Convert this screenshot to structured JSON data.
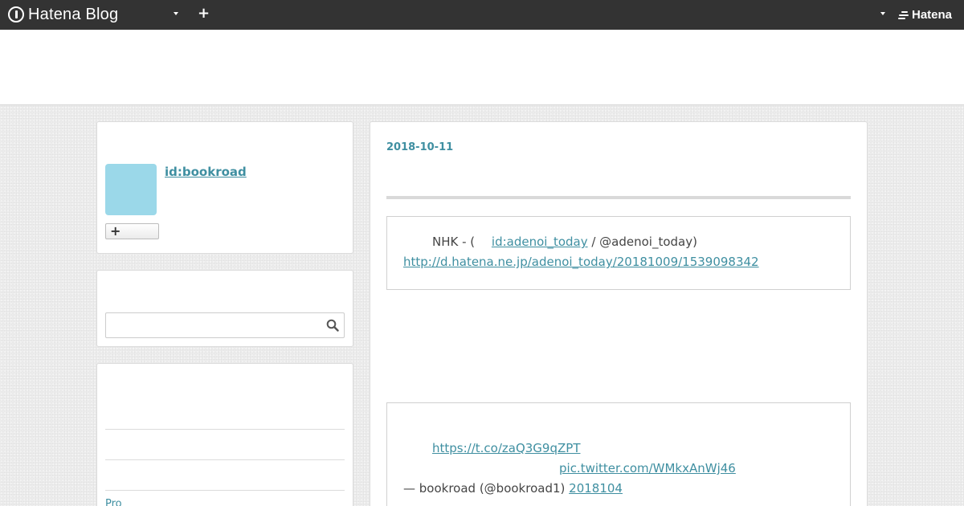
{
  "globalheader": {
    "logo_text": "Hatena Blog",
    "hatena_text": "Hatena",
    "icons": [
      "hatena-blog-logo-icon",
      "chevron-down-icon",
      "plus-icon",
      "hatena-logo-icon"
    ]
  },
  "profile": {
    "id_label": "id:bookroad",
    "follow_icon": "plus-icon",
    "avatar_color": "#9bd8e9"
  },
  "search": {
    "placeholder": "",
    "icon": "search-icon"
  },
  "archive": {
    "pro_label": "Pro"
  },
  "entry": {
    "date": "2018-10-11",
    "quote1": {
      "prefix": "NHK -  ( ",
      "link": "id:adenoi_today",
      "suffix": " / @adenoi_today)",
      "url": "http://d.hatena.ne.jp/adenoi_today/20181009/1539098342"
    },
    "quote2": {
      "link1": "https://t.co/zaQ3G9qZPT",
      "link2": "pic.twitter.com/WMkxAnWj46",
      "attribution": "— bookroad (@bookroad1)",
      "date_link": "2018104"
    }
  },
  "colors": {
    "header_bg": "#333333",
    "link": "#3f8fa1",
    "page_bg": "#ececec"
  }
}
